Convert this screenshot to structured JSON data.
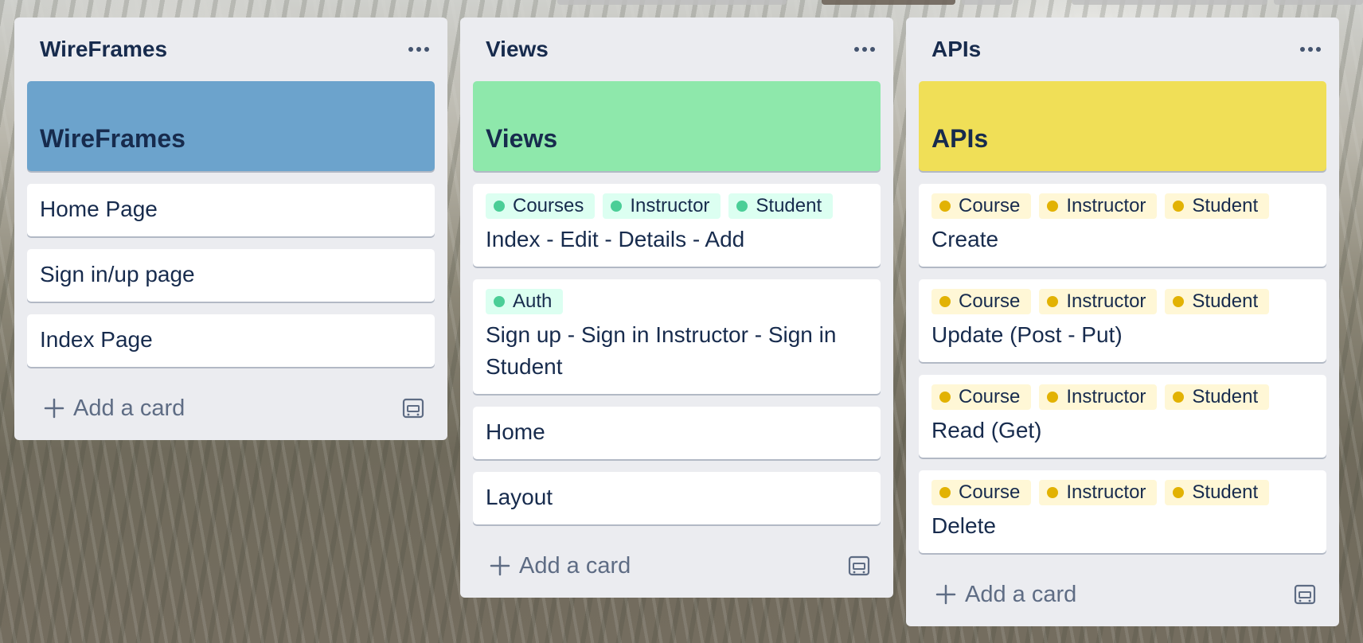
{
  "lists": [
    {
      "title": "WireFrames",
      "cover": {
        "title": "WireFrames",
        "color": "#6ca3cc"
      },
      "cards": [
        {
          "title": "Home Page"
        },
        {
          "title": "Sign in/up page"
        },
        {
          "title": "Index Page"
        }
      ],
      "add_card_label": "Add a card"
    },
    {
      "title": "Views",
      "cover": {
        "title": "Views",
        "color": "#8ee8ab"
      },
      "cards": [
        {
          "title": "Index - Edit - Details - Add",
          "labels": [
            "Courses",
            "Instructor",
            "Student"
          ]
        },
        {
          "title": "Sign up - Sign in Instructor - Sign in Student",
          "labels": [
            "Auth"
          ]
        },
        {
          "title": "Home"
        },
        {
          "title": "Layout"
        }
      ],
      "add_card_label": "Add a card"
    },
    {
      "title": "APIs",
      "cover": {
        "title": "APIs",
        "color": "#f0df57"
      },
      "cards": [
        {
          "title": "Create",
          "labels": [
            "Course",
            "Instructor",
            "Student"
          ]
        },
        {
          "title": "Update (Post - Put)",
          "labels": [
            "Course",
            "Instructor",
            "Student"
          ]
        },
        {
          "title": "Read (Get)",
          "labels": [
            "Course",
            "Instructor",
            "Student"
          ]
        },
        {
          "title": "Delete",
          "labels": [
            "Course",
            "Instructor",
            "Student"
          ]
        }
      ],
      "add_card_label": "Add a card"
    }
  ],
  "label_colors": {
    "green": {
      "bg": "#dcfff1",
      "dot": "#4bce97"
    },
    "yellow": {
      "bg": "#fff7d6",
      "dot": "#e2b203"
    }
  },
  "icons": {
    "list_menu": "more-horizontal-icon",
    "add": "plus-icon",
    "template": "card-template-icon"
  }
}
